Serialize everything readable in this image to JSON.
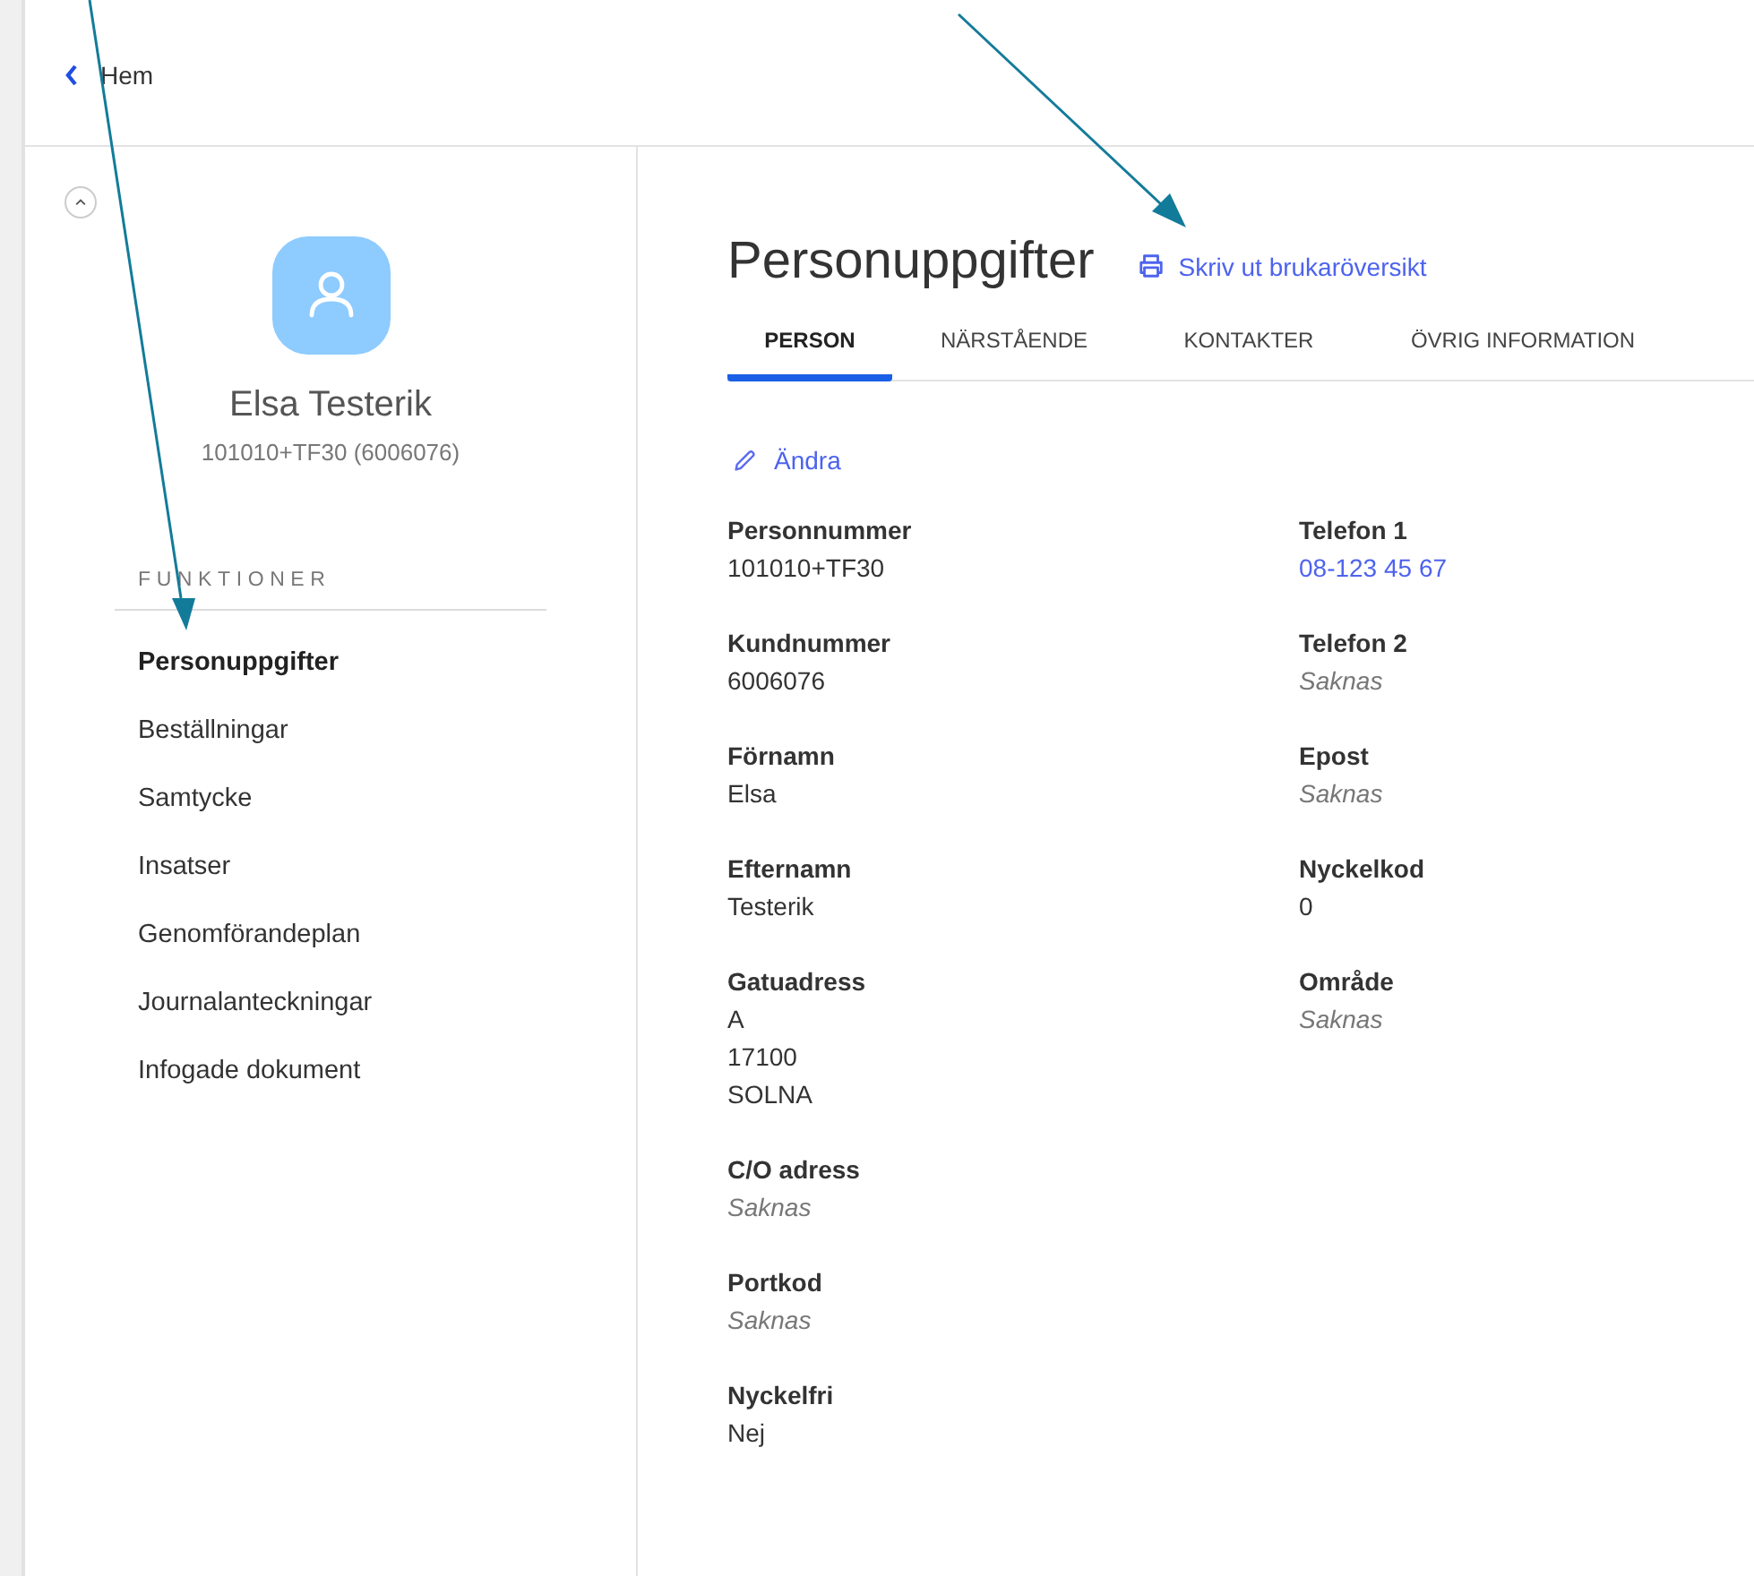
{
  "header": {
    "back_link": "Hem"
  },
  "sidebar": {
    "expanded": true,
    "person_name": "Elsa Testerik",
    "person_id": "101010+TF30 (6006076)",
    "section_title": "FUNKTIONER",
    "items": [
      {
        "label": "Personuppgifter",
        "selected": true
      },
      {
        "label": "Beställningar",
        "selected": false
      },
      {
        "label": "Samtycke",
        "selected": false
      },
      {
        "label": "Insatser",
        "selected": false
      },
      {
        "label": "Genomförandeplan",
        "selected": false
      },
      {
        "label": "Journalanteckningar",
        "selected": false
      },
      {
        "label": "Infogade dokument",
        "selected": false
      }
    ]
  },
  "main": {
    "title": "Personuppgifter",
    "print_link": "Skriv ut brukaröversikt",
    "tabs": [
      {
        "label": "PERSON",
        "selected": true
      },
      {
        "label": "NÄRSTÅENDE",
        "selected": false
      },
      {
        "label": "KONTAKTER",
        "selected": false
      },
      {
        "label": "ÖVRIG INFORMATION",
        "selected": false
      }
    ],
    "edit_link": "Ändra",
    "columns": [
      [
        {
          "label": "Personnummer",
          "values": [
            {
              "text": "101010+TF30",
              "kind": "text"
            }
          ]
        },
        {
          "label": "Kundnummer",
          "values": [
            {
              "text": "6006076",
              "kind": "text"
            }
          ]
        },
        {
          "label": "Förnamn",
          "values": [
            {
              "text": "Elsa",
              "kind": "text"
            }
          ]
        },
        {
          "label": "Efternamn",
          "values": [
            {
              "text": "Testerik",
              "kind": "text"
            }
          ]
        },
        {
          "label": "Gatuadress",
          "values": [
            {
              "text": "A",
              "kind": "text"
            },
            {
              "text": "17100",
              "kind": "text"
            },
            {
              "text": "SOLNA",
              "kind": "text"
            }
          ]
        },
        {
          "label": "C/O adress",
          "values": [
            {
              "text": "Saknas",
              "kind": "missing"
            }
          ]
        },
        {
          "label": "Portkod",
          "values": [
            {
              "text": "Saknas",
              "kind": "missing"
            }
          ]
        },
        {
          "label": "Nyckelfri",
          "values": [
            {
              "text": "Nej",
              "kind": "text"
            }
          ]
        }
      ],
      [
        {
          "label": "Telefon 1",
          "values": [
            {
              "text": "08-123 45 67",
              "kind": "link"
            }
          ]
        },
        {
          "label": "Telefon 2",
          "values": [
            {
              "text": "Saknas",
              "kind": "missing"
            }
          ]
        },
        {
          "label": "Epost",
          "values": [
            {
              "text": "Saknas",
              "kind": "missing"
            }
          ]
        },
        {
          "label": "Nyckelkod",
          "values": [
            {
              "text": "0",
              "kind": "text"
            }
          ]
        },
        {
          "label": "Område",
          "values": [
            {
              "text": "Saknas",
              "kind": "missing"
            }
          ]
        }
      ]
    ]
  }
}
